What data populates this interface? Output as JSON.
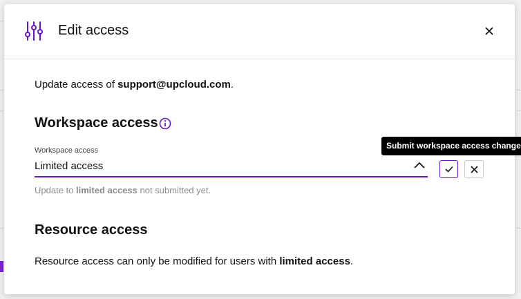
{
  "modal": {
    "title": "Edit access",
    "intro_prefix": "Update access of ",
    "intro_email": "support@upcloud.com",
    "intro_suffix": ".",
    "workspace": {
      "heading": "Workspace access",
      "field_label": "Workspace access",
      "selected_value": "Limited access",
      "tooltip": "Submit workspace access change",
      "hint_prefix": "Update to ",
      "hint_bold": "limited access",
      "hint_suffix": " not submitted yet."
    },
    "resource": {
      "heading": "Resource access",
      "text_prefix": "Resource access can only be modified for users with ",
      "text_bold": "limited access",
      "text_suffix": "."
    }
  },
  "icons": {
    "header": "sliders-icon",
    "close": "close-icon",
    "info": "info-icon",
    "chevron": "chevron-up-icon",
    "confirm": "check-icon",
    "cancel": "close-icon"
  },
  "colors": {
    "accent": "#6a14c9",
    "tooltip_bg": "#000000",
    "hint_text": "#8a8a8a"
  }
}
